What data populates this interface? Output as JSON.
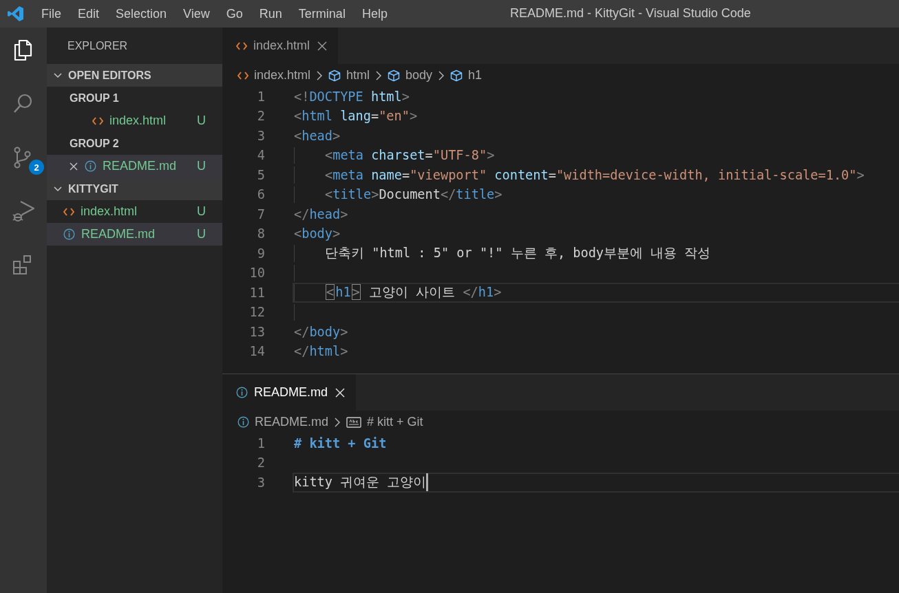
{
  "menu": [
    "File",
    "Edit",
    "Selection",
    "View",
    "Go",
    "Run",
    "Terminal",
    "Help"
  ],
  "window": {
    "title": "README.md - KittyGit - Visual Studio Code"
  },
  "activity_bar": [
    {
      "kind": "explorer",
      "selected": true
    },
    {
      "kind": "search",
      "selected": false
    },
    {
      "kind": "scm",
      "selected": false,
      "badge": "2"
    },
    {
      "kind": "debug",
      "selected": false
    },
    {
      "kind": "extensions",
      "selected": false
    }
  ],
  "sidebar": {
    "title": "EXPLORER",
    "sections": [
      {
        "label": "OPEN EDITORS",
        "expanded": true,
        "groups": [
          {
            "label": "GROUP 1",
            "items": [
              {
                "name": "index.html",
                "kind": "html",
                "status": "U",
                "closable": false,
                "selected": false
              }
            ]
          },
          {
            "label": "GROUP 2",
            "items": [
              {
                "name": "README.md",
                "kind": "info",
                "status": "U",
                "closable": true,
                "selected": true
              }
            ]
          }
        ]
      },
      {
        "label": "KITTYGIT",
        "expanded": true,
        "groups": [
          {
            "items": [
              {
                "name": "index.html",
                "kind": "html",
                "status": "U",
                "closable": false,
                "selected": false
              },
              {
                "name": "README.md",
                "kind": "info",
                "status": "U",
                "closable": false,
                "selected": true
              }
            ]
          }
        ]
      }
    ]
  },
  "editor_groups": [
    {
      "tabs": [
        {
          "label": "index.html",
          "kind": "html",
          "selected": true,
          "focused": false
        }
      ],
      "breadcrumb": [
        {
          "label": "index.html",
          "kind": "html"
        },
        {
          "label": "html",
          "kind": "element"
        },
        {
          "label": "body",
          "kind": "element"
        },
        {
          "label": "h1",
          "kind": "element"
        }
      ],
      "lines": [
        {
          "number": "1",
          "kind": "plain",
          "current": false,
          "tokens": [
            {
              "text": "<!",
              "kind": "punct"
            },
            {
              "text": "DOCTYPE",
              "kind": "tag"
            },
            {
              "text": " html",
              "kind": "attr"
            },
            {
              "text": ">",
              "kind": "punct"
            }
          ]
        },
        {
          "number": "2",
          "kind": "plain",
          "current": false,
          "tokens": [
            {
              "text": "<",
              "kind": "punct"
            },
            {
              "text": "html",
              "kind": "tag"
            },
            {
              "text": " lang",
              "kind": "attr"
            },
            {
              "text": "=",
              "kind": "text"
            },
            {
              "text": "\"en\"",
              "kind": "string"
            },
            {
              "text": ">",
              "kind": "punct"
            }
          ]
        },
        {
          "number": "3",
          "kind": "plain",
          "current": false,
          "tokens": [
            {
              "text": "<",
              "kind": "punct"
            },
            {
              "text": "head",
              "kind": "tag"
            },
            {
              "text": ">",
              "kind": "punct"
            }
          ]
        },
        {
          "number": "4",
          "kind": "nested",
          "current": false,
          "tokens": [
            {
              "text": "<",
              "kind": "punct"
            },
            {
              "text": "meta",
              "kind": "tag"
            },
            {
              "text": " charset",
              "kind": "attr"
            },
            {
              "text": "=",
              "kind": "text"
            },
            {
              "text": "\"UTF-8\"",
              "kind": "string"
            },
            {
              "text": ">",
              "kind": "punct"
            }
          ]
        },
        {
          "number": "5",
          "kind": "nested",
          "current": false,
          "tokens": [
            {
              "text": "<",
              "kind": "punct"
            },
            {
              "text": "meta",
              "kind": "tag"
            },
            {
              "text": " name",
              "kind": "attr"
            },
            {
              "text": "=",
              "kind": "text"
            },
            {
              "text": "\"viewport\"",
              "kind": "string"
            },
            {
              "text": " content",
              "kind": "attr"
            },
            {
              "text": "=",
              "kind": "text"
            },
            {
              "text": "\"width=device-width, initial-scale=1.0\"",
              "kind": "string"
            },
            {
              "text": ">",
              "kind": "punct"
            }
          ]
        },
        {
          "number": "6",
          "kind": "nested",
          "current": false,
          "tokens": [
            {
              "text": "<",
              "kind": "punct"
            },
            {
              "text": "title",
              "kind": "tag"
            },
            {
              "text": ">",
              "kind": "punct"
            },
            {
              "text": "Document",
              "kind": "text"
            },
            {
              "text": "</",
              "kind": "punct"
            },
            {
              "text": "title",
              "kind": "tag"
            },
            {
              "text": ">",
              "kind": "punct"
            }
          ]
        },
        {
          "number": "7",
          "kind": "plain",
          "current": false,
          "tokens": [
            {
              "text": "</",
              "kind": "punct"
            },
            {
              "text": "head",
              "kind": "tag"
            },
            {
              "text": ">",
              "kind": "punct"
            }
          ]
        },
        {
          "number": "8",
          "kind": "plain",
          "current": false,
          "tokens": [
            {
              "text": "<",
              "kind": "punct"
            },
            {
              "text": "body",
              "kind": "tag"
            },
            {
              "text": ">",
              "kind": "punct"
            }
          ]
        },
        {
          "number": "9",
          "kind": "nested",
          "current": false,
          "tokens": [
            {
              "text": "단축키 \"html : 5\" or \"!\" 누른 후, body부분에 내용 작성",
              "kind": "text"
            }
          ]
        },
        {
          "number": "10",
          "kind": "nested",
          "current": false
        },
        {
          "number": "11",
          "kind": "nested",
          "current": true,
          "tokens": [
            {
              "text": "<",
              "kind": "match"
            },
            {
              "text": "h1",
              "kind": "tag"
            },
            {
              "text": ">",
              "kind": "match"
            },
            {
              "text": " 고양이 사이트 ",
              "kind": "text"
            },
            {
              "text": "</",
              "kind": "punct"
            },
            {
              "text": "h1",
              "kind": "tag"
            },
            {
              "text": ">",
              "kind": "punct"
            }
          ]
        },
        {
          "number": "12",
          "kind": "nested",
          "current": false
        },
        {
          "number": "13",
          "kind": "plain",
          "current": false,
          "tokens": [
            {
              "text": "</",
              "kind": "punct"
            },
            {
              "text": "body",
              "kind": "tag"
            },
            {
              "text": ">",
              "kind": "punct"
            }
          ]
        },
        {
          "number": "14",
          "kind": "plain",
          "current": false,
          "tokens": [
            {
              "text": "</",
              "kind": "punct"
            },
            {
              "text": "html",
              "kind": "tag"
            },
            {
              "text": ">",
              "kind": "punct"
            }
          ]
        }
      ]
    },
    {
      "tabs": [
        {
          "label": "README.md",
          "kind": "info",
          "selected": true,
          "focused": true
        }
      ],
      "breadcrumb": [
        {
          "label": "README.md",
          "kind": "info"
        },
        {
          "label": "# kitt + Git",
          "kind": "symbol"
        }
      ],
      "lines": [
        {
          "number": "1",
          "kind": "plain",
          "current": false,
          "cursor": false,
          "tokens": [
            {
              "text": "# kitt + Git",
              "kind": "heading"
            }
          ]
        },
        {
          "number": "2",
          "kind": "plain",
          "current": false,
          "cursor": false
        },
        {
          "number": "3",
          "kind": "plain",
          "current": true,
          "cursor": true,
          "tokens": [
            {
              "text": "kitty 귀여운 고양이",
              "kind": "text"
            }
          ]
        }
      ]
    }
  ]
}
